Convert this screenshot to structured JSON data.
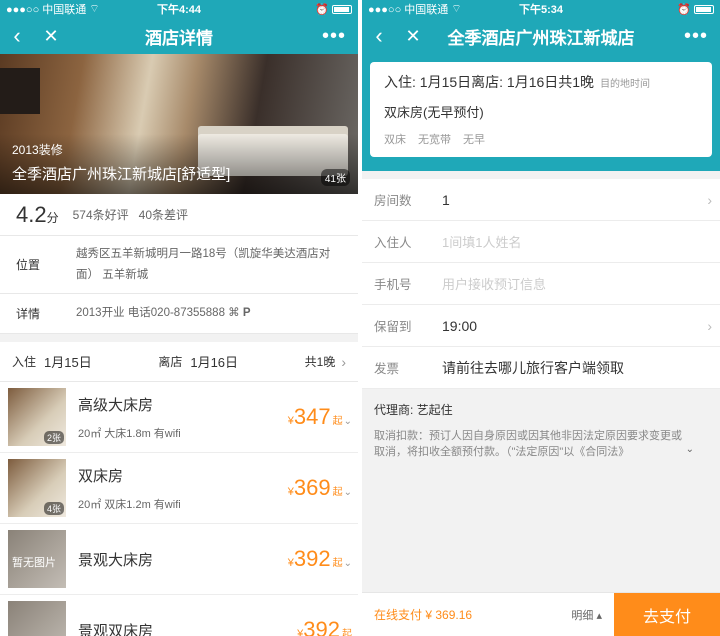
{
  "left": {
    "status": {
      "carrier": "●●●○○ 中国联通",
      "time": "下午4:44"
    },
    "nav": {
      "back": "‹",
      "close": "✕",
      "title": "酒店详情",
      "more": "•••"
    },
    "hero": {
      "year": "2013装修",
      "name": "全季酒店广州珠江新城店[舒适型]",
      "count": "41张"
    },
    "rating": {
      "score": "4.2",
      "unit": "分",
      "good": "574条好评",
      "bad": "40条差评"
    },
    "location": {
      "label": "位置",
      "value": "越秀区五羊新城明月一路18号（凯旋华美达酒店对面）  五羊新城"
    },
    "details": {
      "label": "详情",
      "value": "2013开业  电话020-87355888",
      "wifi_icon": "wifi-icon",
      "parking": "P"
    },
    "dates": {
      "checkin_label": "入住",
      "checkin": "1月15日",
      "checkout_label": "离店",
      "checkout": "1月16日",
      "nights": "共1晚"
    },
    "rooms": [
      {
        "name": "高级大床房",
        "desc": "20㎡ 大床1.8m 有wifi",
        "yen": "¥",
        "price": "347",
        "qi": "起",
        "photo_count": "2张",
        "placeholder": ""
      },
      {
        "name": "双床房",
        "desc": "20㎡ 双床1.2m 有wifi",
        "yen": "¥",
        "price": "369",
        "qi": "起",
        "photo_count": "4张",
        "placeholder": ""
      },
      {
        "name": "景观大床房",
        "desc": "",
        "yen": "¥",
        "price": "392",
        "qi": "起",
        "photo_count": "",
        "placeholder": "暂无图片"
      },
      {
        "name": "景观双床房",
        "desc": "",
        "yen": "¥",
        "price": "392",
        "qi": "起",
        "photo_count": "",
        "placeholder": ""
      }
    ]
  },
  "right": {
    "status": {
      "carrier": "●●●○○ 中国联通",
      "time": "下午5:34"
    },
    "nav": {
      "back": "‹",
      "close": "✕",
      "title": "全季酒店广州珠江新城店",
      "more": "•••"
    },
    "booking": {
      "line": "入住: 1月15日离店: 1月16日共1晚",
      "tz": "目的地时间",
      "room_type": "双床房(无早预付)",
      "tags": [
        "双床",
        "无宽带",
        "无早"
      ]
    },
    "form": {
      "rooms_label": "房间数",
      "rooms_value": "1",
      "guest_label": "入住人",
      "guest_placeholder": "1间填1人姓名",
      "phone_label": "手机号",
      "phone_placeholder": "用户接收预订信息",
      "hold_label": "保留到",
      "hold_value": "19:00",
      "invoice_label": "发票",
      "invoice_value": "请前往去哪儿旅行客户端领取"
    },
    "agent": {
      "line": "代理商:  艺起住",
      "cancel": "取消扣款：预订人因自身原因或因其他非因法定原因要求变更或取消，将扣收全额预付款。（\"法定原因\"以《合同法》"
    },
    "pay": {
      "online": "在线支付 ¥ 369.16",
      "detail": "明细 ▴",
      "button": "去支付"
    }
  },
  "colors": {
    "accent": "#1fa8b8",
    "price": "#ff8c1a"
  }
}
